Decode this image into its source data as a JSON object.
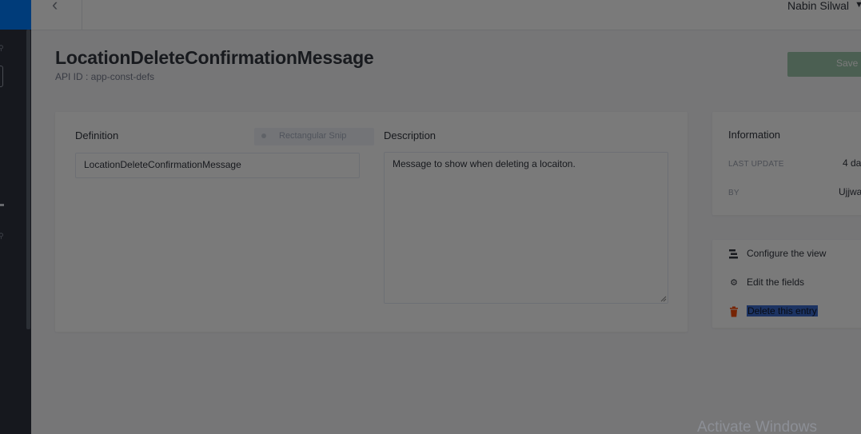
{
  "header": {
    "back_icon": "chevron-left-icon",
    "user_name": "Nabin Silwal",
    "caret_icon": "caret-down-icon"
  },
  "page": {
    "title": "LocationDeleteConfirmationMessage",
    "api_id": "API ID : app-const-defs",
    "save_label": "Save"
  },
  "form": {
    "definition_label": "Definition",
    "definition_value": "LocationDeleteConfirmationMessage",
    "description_label": "Description",
    "description_value": "Message to show when deleting a locaiton."
  },
  "snip_tooltip": "Rectangular Snip",
  "info": {
    "title": "Information",
    "last_update_label": "LAST UPDATE",
    "last_update_value": "4 da",
    "by_label": "BY",
    "by_value": "Ujjwa"
  },
  "actions": [
    {
      "label": "Configure the view",
      "icon": "layout-icon"
    },
    {
      "label": "Edit the fields",
      "icon": "gear-icon"
    },
    {
      "label": "Delete this entry",
      "icon": "trash-icon"
    }
  ],
  "watermark": "Activate Windows",
  "colors": {
    "brand": "#007eff",
    "delete": "#f64d0a",
    "save": "#6dbb1a"
  }
}
